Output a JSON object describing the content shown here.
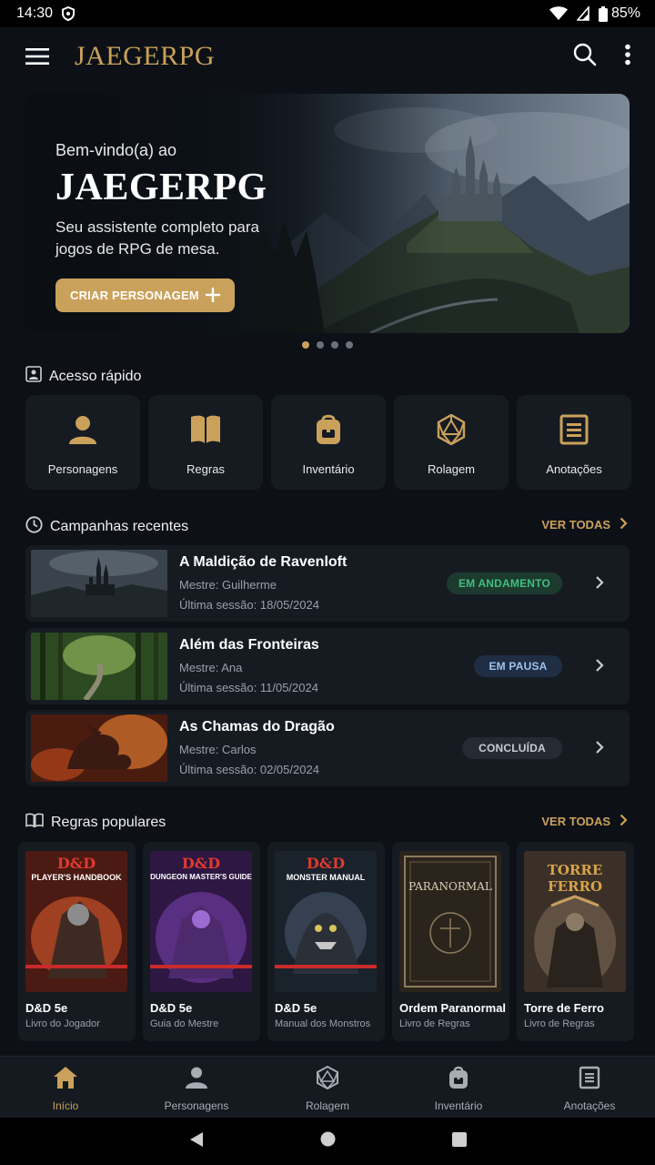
{
  "status_bar": {
    "time": "14:30",
    "battery": "85%"
  },
  "app_bar": {
    "logo": "JAEGERPG",
    "icons": [
      "menu-icon",
      "search-icon",
      "more-vert-icon"
    ]
  },
  "hero": {
    "welcome": "Bem-vindo(a) ao",
    "title": "JAEGERPG",
    "subtitle": "Seu assistente completo para jogos de RPG de mesa.",
    "cta_label": "CRIAR PERSONAGEM",
    "active_slide": 1,
    "slide_count": 4
  },
  "quick_access": {
    "heading": "Acesso rápido",
    "items": [
      {
        "label": "Personagens",
        "icon": "person-icon"
      },
      {
        "label": "Regras",
        "icon": "book-icon"
      },
      {
        "label": "Inventário",
        "icon": "backpack-icon"
      },
      {
        "label": "Rolagem",
        "icon": "d20-icon"
      },
      {
        "label": "Anotações",
        "icon": "notes-icon"
      }
    ]
  },
  "campaigns": {
    "heading": "Campanhas recentes",
    "see_all": "VER TODAS",
    "items": [
      {
        "name": "A Maldição de Ravenloft",
        "master": "Mestre: Guilherme",
        "last_session": "Última sessão: 18/05/2024",
        "status": "EM ANDAMENTO",
        "status_color": "#3fbf7f"
      },
      {
        "name": "Além das Fronteiras",
        "master": "Mestre: Ana",
        "last_session": "Última sessão: 11/05/2024",
        "status": "EM PAUSA",
        "status_color": "#9ec3ee"
      },
      {
        "name": "As Chamas do Dragão",
        "master": "Mestre: Carlos",
        "last_session": "Última sessão: 02/05/2024",
        "status": "CONCLUÍDA",
        "status_color": "#c8ccd2"
      }
    ]
  },
  "rules": {
    "heading": "Regras populares",
    "see_all": "VER TODAS",
    "items": [
      {
        "title": "D&D 5e",
        "subtitle": "Livro do Jogador",
        "cover_brand": "D&D",
        "cover_title": "PLAYER'S HANDBOOK"
      },
      {
        "title": "D&D 5e",
        "subtitle": "Guia do Mestre",
        "cover_brand": "D&D",
        "cover_title": "DUNGEON MASTER'S GUIDE"
      },
      {
        "title": "D&D 5e",
        "subtitle": "Manual dos Monstros",
        "cover_brand": "D&D",
        "cover_title": "MONSTER MANUAL"
      },
      {
        "title": "Ordem Paranormal",
        "subtitle": "Livro de Regras",
        "cover_brand": "",
        "cover_title": "PARANORMAL"
      },
      {
        "title": "Torre de Ferro",
        "subtitle": "Livro de Regras",
        "cover_brand": "",
        "cover_title": "TORRE FERRO"
      }
    ]
  },
  "bottom_nav": {
    "active": "Início",
    "items": [
      {
        "label": "Início",
        "icon": "home-icon"
      },
      {
        "label": "Personagens",
        "icon": "person-icon"
      },
      {
        "label": "Rolagem",
        "icon": "d20-icon"
      },
      {
        "label": "Inventário",
        "icon": "backpack-icon"
      },
      {
        "label": "Anotações",
        "icon": "notes-icon"
      }
    ]
  },
  "colors": {
    "accent": "#caa15b",
    "background": "#0d1117",
    "card": "#161b22"
  }
}
